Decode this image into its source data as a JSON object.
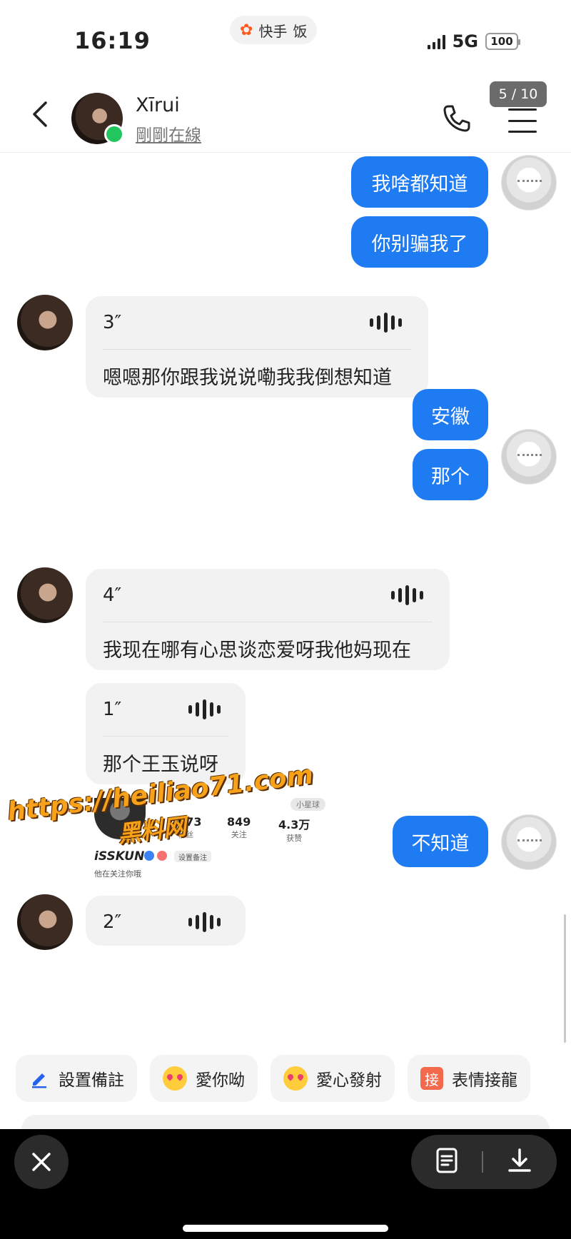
{
  "status_bar": {
    "time": "16:19",
    "app_label": "快手",
    "app_suffix": "饭",
    "network": "5G",
    "battery": "100"
  },
  "header": {
    "contact_name": "Xīrui",
    "contact_status": "剛剛在線",
    "page_indicator": "5 / 10"
  },
  "messages": {
    "m1": "我啥都知道",
    "m2": "你别骗我了",
    "v1_duration": "3″",
    "v1_text": "嗯嗯那你跟我说说嘞我我倒想知道",
    "m3": "安徽",
    "m4": "那个",
    "v2_duration": "4″",
    "v2_text": "我现在哪有心思谈恋爱呀我他妈现在",
    "v3_duration": "1″",
    "v3_text": "那个王玉说呀",
    "m5": "不知道",
    "v4_duration": "2″"
  },
  "profile_card": {
    "tag": "小星球",
    "fans_count": "2073",
    "fans_label": "粉丝",
    "following_count": "849",
    "following_label": "关注",
    "likes_count": "4.3万",
    "likes_label": "获赞",
    "name": "iSSKUN",
    "note_button": "设置备注",
    "follow_status": "他在关注你哦"
  },
  "watermark": {
    "url": "https://heiliao71.com",
    "name": "黑料网"
  },
  "quick_actions": {
    "set_note": "設置備註",
    "love_you": "愛你呦",
    "love_launch": "愛心發射",
    "emoji_relay_icon": "接",
    "emoji_relay": "表情接龍"
  },
  "icons": {
    "back": "chevron-left-icon",
    "call": "phone-icon",
    "menu": "menu-icon",
    "close": "close-icon",
    "notes": "notes-icon",
    "download": "download-icon"
  },
  "colors": {
    "bubble_blue": "#1f7bf2",
    "online_green": "#22c55e",
    "voice_bg": "#f2f2f2",
    "watermark_orange": "#f7a21a"
  }
}
